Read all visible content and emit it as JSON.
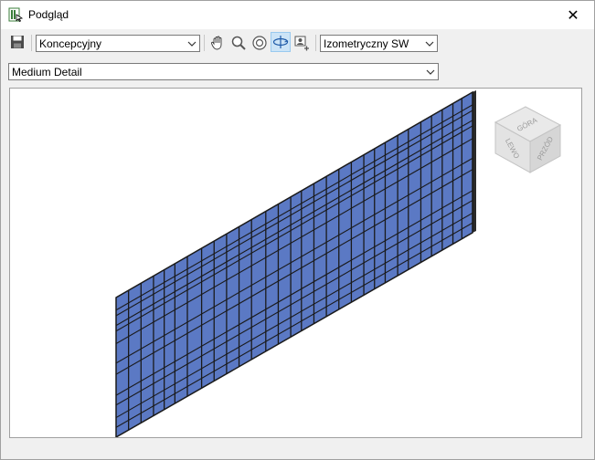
{
  "window": {
    "title": "Podgląd",
    "close_glyph": "✕"
  },
  "toolbar": {
    "save_icon": "save-icon",
    "visual_style": "Koncepcyjny",
    "tools": [
      "pan-icon",
      "zoom-icon",
      "zoom-fit-icon",
      "orbit-icon",
      "camera-icon"
    ],
    "active_tool": "orbit-icon",
    "view": "Izometryczny SW"
  },
  "detail_level": {
    "value": "Medium Detail"
  },
  "viewcube": {
    "top": "GÓRA",
    "left": "LEWO",
    "front": "PRZÓD"
  },
  "colors": {
    "panel_fill": "#5b79c4",
    "panel_edge": "#1a1a1a",
    "active_tool_bg": "#cce4f7"
  }
}
